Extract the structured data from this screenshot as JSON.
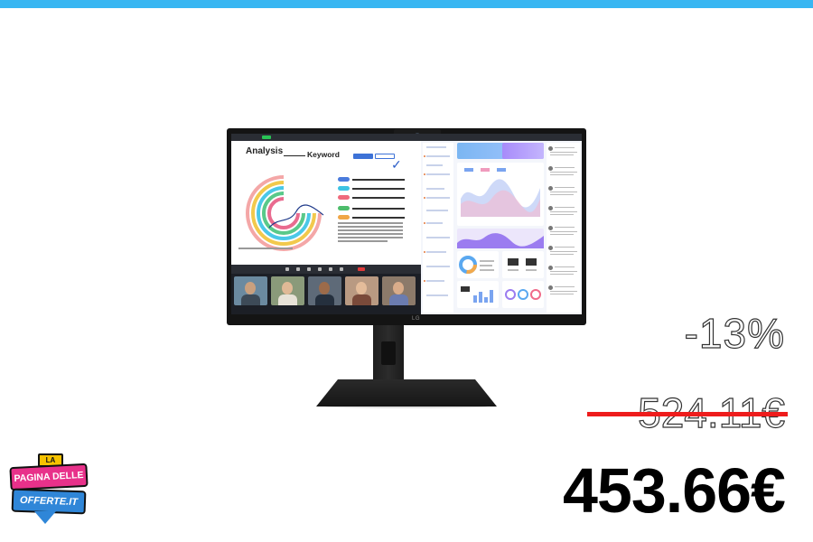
{
  "colors": {
    "top_bar": "#38b6f2",
    "strike_line": "#ee1c1c",
    "new_price": "#000000",
    "brand_pink": "#e8318a",
    "brand_blue": "#2f86d8",
    "brand_yellow": "#f6c200"
  },
  "product_image": {
    "screen": {
      "slide_title": "Analysis",
      "slide_keyword": "Keyword",
      "brand": "LG"
    }
  },
  "pricing": {
    "discount": "-13%",
    "old_price": "524.11€",
    "new_price": "453.66€"
  },
  "logo": {
    "line1": "LA",
    "line2": "PAGINA DELLE",
    "line3": "OFFERTE.IT"
  }
}
